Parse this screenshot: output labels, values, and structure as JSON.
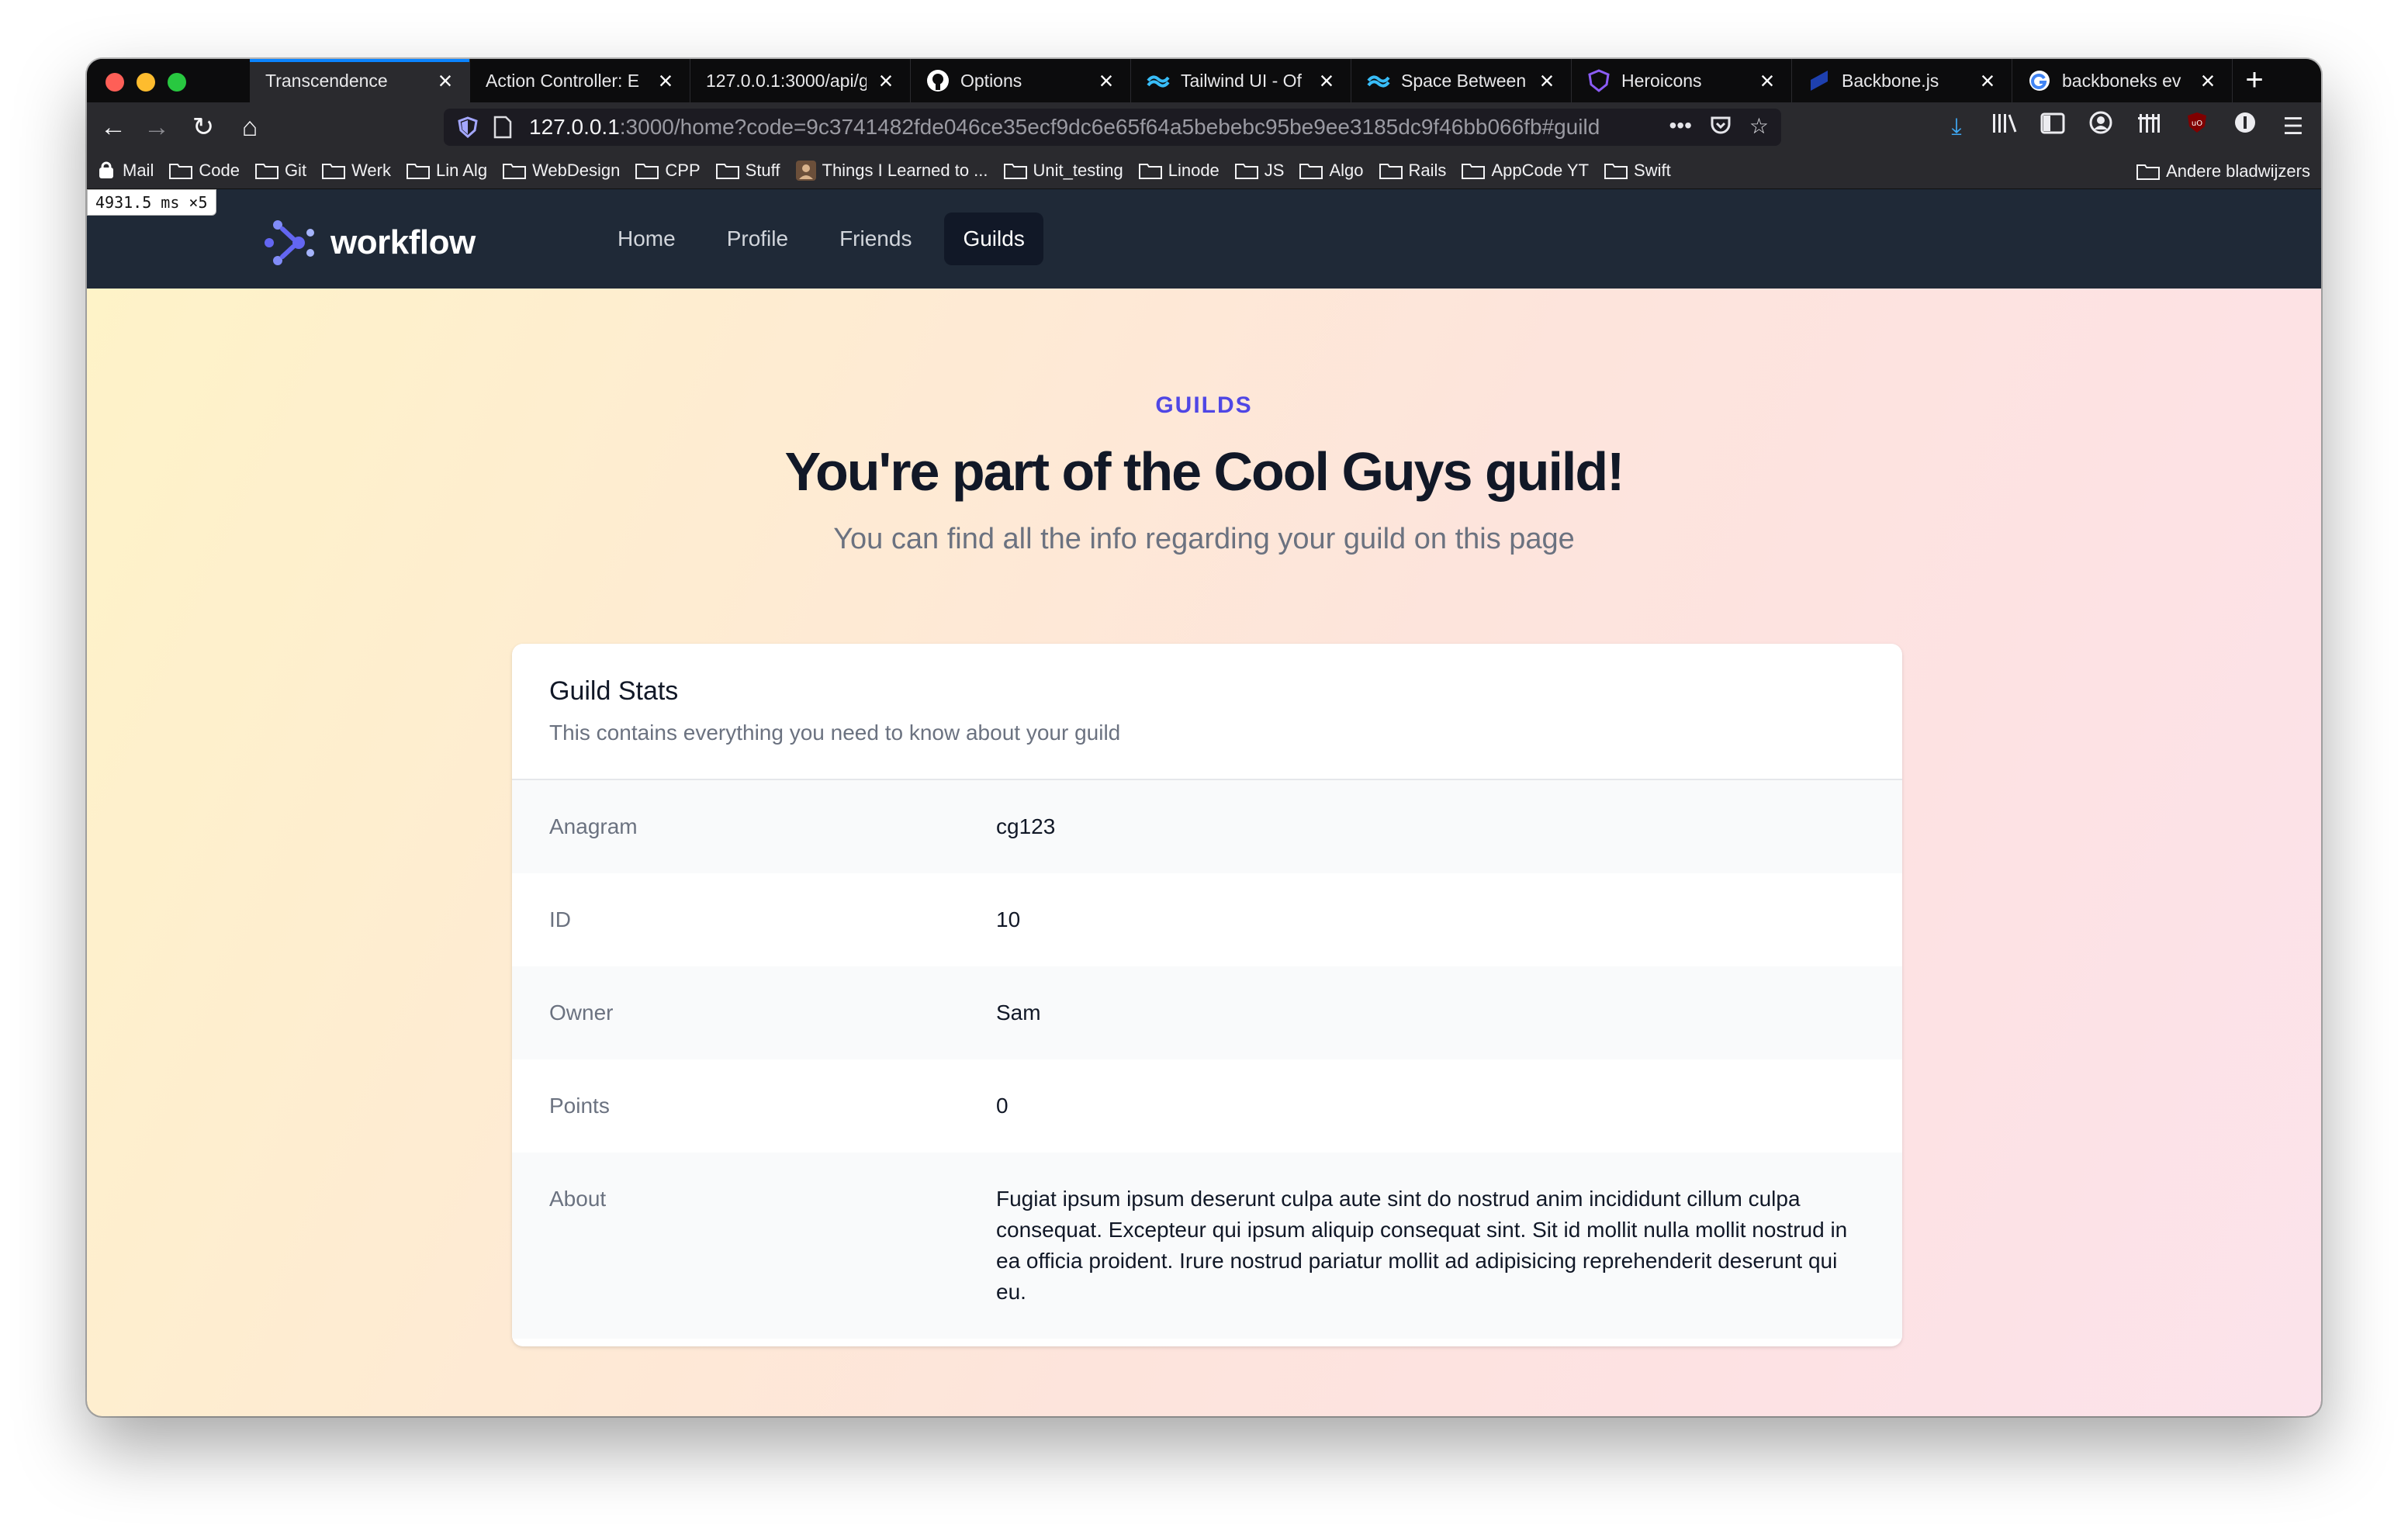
{
  "browser": {
    "tabs": [
      {
        "title": "Transcendence",
        "icon": "none",
        "active": true
      },
      {
        "title": "Action Controller: E",
        "icon": "none",
        "active": false
      },
      {
        "title": "127.0.0.1:3000/api/g",
        "icon": "none",
        "active": false
      },
      {
        "title": "Options",
        "icon": "github-icon",
        "active": false
      },
      {
        "title": "Tailwind UI - Of",
        "icon": "tailwind-icon",
        "active": false
      },
      {
        "title": "Space Between",
        "icon": "tailwind-icon",
        "active": false
      },
      {
        "title": "Heroicons",
        "icon": "heroicons-icon",
        "active": false
      },
      {
        "title": "Backbone.js",
        "icon": "backbone-icon",
        "active": false
      },
      {
        "title": "backboneks ev",
        "icon": "google-icon",
        "active": false
      }
    ],
    "url": {
      "host": "127.0.0.1",
      "rest": ":3000/home?code=9c3741482fde046ce35ecf9dc6e65f64a5bebebc95be9ee3185dc9f46bb066fb#guild"
    },
    "bookmarks": [
      "Mail",
      "Code",
      "Git",
      "Werk",
      "Lin Alg",
      "WebDesign",
      "CPP",
      "Stuff",
      "Things I Learned to ...",
      "Unit_testing",
      "Linode",
      "JS",
      "Algo",
      "Rails",
      "AppCode YT",
      "Swift"
    ],
    "other_bookmarks": "Andere bladwijzers",
    "timer": "4931.5 ms ×5"
  },
  "site": {
    "brand": "workflow",
    "nav": [
      {
        "label": "Home",
        "active": false
      },
      {
        "label": "Profile",
        "active": false
      },
      {
        "label": "Friends",
        "active": false
      },
      {
        "label": "Guilds",
        "active": true
      }
    ],
    "accent_color": "#4f46e5"
  },
  "hero": {
    "eyebrow": "GUILDS",
    "title": "You're part of the Cool Guys guild!",
    "subtitle": "You can find all the info regarding your guild on this page"
  },
  "card": {
    "title": "Guild Stats",
    "description": "This contains everything you need to know about your guild",
    "rows": [
      {
        "label": "Anagram",
        "value": "cg123"
      },
      {
        "label": "ID",
        "value": "10"
      },
      {
        "label": "Owner",
        "value": "Sam"
      },
      {
        "label": "Points",
        "value": "0"
      },
      {
        "label": "About",
        "value": "Fugiat ipsum ipsum deserunt culpa aute sint do nostrud anim incididunt cillum culpa consequat. Excepteur qui ipsum aliquip consequat sint. Sit id mollit nulla mollit nostrud in ea officia proident. Irure nostrud pariatur mollit ad adipisicing reprehenderit deserunt qui eu."
      }
    ]
  }
}
